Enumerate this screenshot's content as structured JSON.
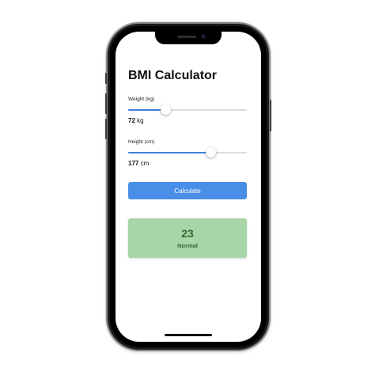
{
  "app": {
    "title": "BMI Calculator"
  },
  "weight": {
    "label": "Weight (kg)",
    "value": "72",
    "unit": "kg",
    "slider_fraction": 0.31
  },
  "height": {
    "label": "Height (cm)",
    "value": "177",
    "unit": "cm",
    "slider_fraction": 0.69
  },
  "actions": {
    "calculate_label": "Calculate"
  },
  "result": {
    "value": "23",
    "category": "Normal"
  },
  "colors": {
    "accent": "#4a8fe7",
    "result_bg": "#a9d6a9",
    "result_text": "#2f6b2f"
  }
}
